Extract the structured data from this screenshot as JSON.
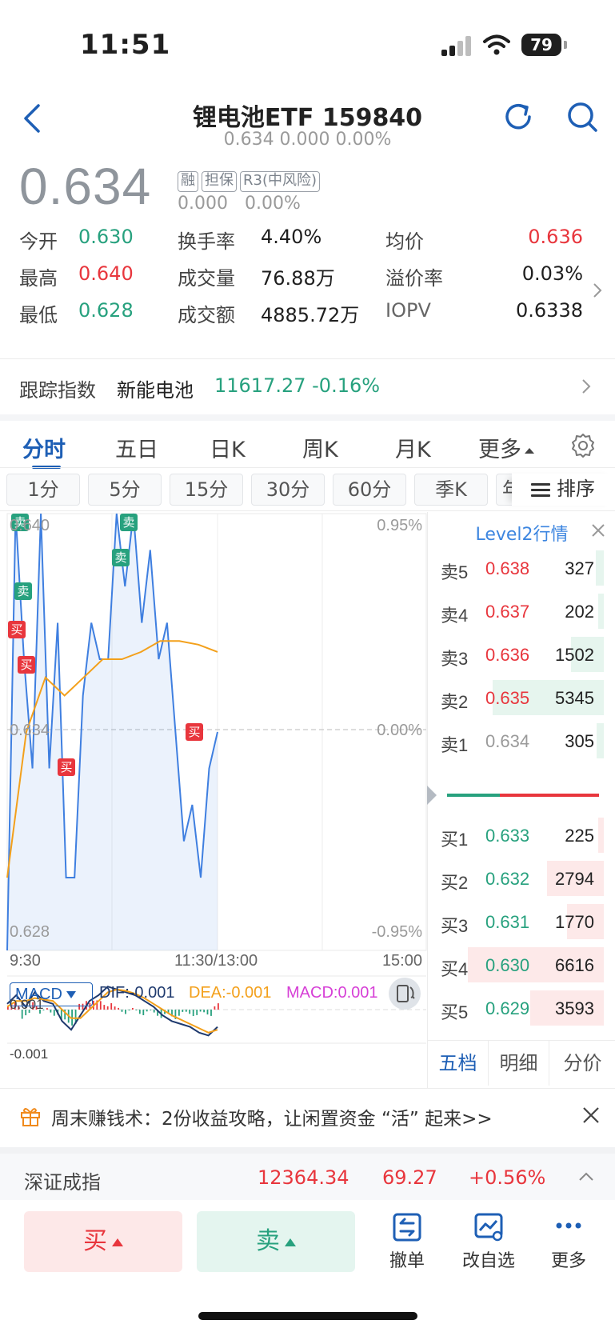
{
  "status": {
    "time": "11:51",
    "battery": "79"
  },
  "header": {
    "title": "锂电池ETF 159840",
    "subtitle": "0.634 0.000 0.00%"
  },
  "price": {
    "last": "0.634",
    "change": "0.000  0.00%",
    "tags": [
      "融",
      "担保",
      "R3(中风险)"
    ]
  },
  "quote": {
    "open_label": "今开",
    "open": "0.630",
    "high_label": "最高",
    "high": "0.640",
    "low_label": "最低",
    "low": "0.628",
    "turnover_label": "换手率",
    "turnover": "4.40%",
    "volume_label": "成交量",
    "volume": "76.88万",
    "amount_label": "成交额",
    "amount": "4885.72万",
    "avg_label": "均价",
    "avg": "0.636",
    "premium_label": "溢价率",
    "premium": "0.03%",
    "iopv_label": "IOPV",
    "iopv": "0.6338"
  },
  "track": {
    "label": "跟踪指数",
    "name": "新能电池",
    "value": "11617.27 -0.16%"
  },
  "tabs": [
    "分时",
    "五日",
    "日K",
    "周K",
    "月K",
    "更多"
  ],
  "period_tabs": [
    "1分",
    "5分",
    "15分",
    "30分",
    "60分",
    "季K",
    "年"
  ],
  "sort_label": "排序",
  "chart": {
    "ymax": "0.640",
    "ymid": "0.634",
    "ymin": "0.628",
    "pmax": "0.95%",
    "pmid": "0.00%",
    "pmin": "-0.95%",
    "t_start": "9:30",
    "t_mid": "11:30/13:00",
    "t_end": "15:00",
    "buy_mark": "买",
    "sell_mark": "卖",
    "colors": {
      "price": "#3f7fe0",
      "avg": "#f3a01b"
    }
  },
  "chart_data": {
    "type": "line",
    "ylim": [
      0.628,
      0.64
    ],
    "series": [
      {
        "values": [
          0.628,
          0.64,
          0.636,
          0.633,
          0.64,
          0.633,
          0.637,
          0.63,
          0.63,
          0.635,
          0.637,
          0.636,
          0.636,
          0.64,
          0.638,
          0.64,
          0.637,
          0.639,
          0.636,
          0.637,
          0.634,
          0.631,
          0.632,
          0.63,
          0.633,
          0.634
        ]
      },
      {
        "values": [
          0.63,
          0.634,
          0.6355,
          0.635,
          0.6355,
          0.636,
          0.636,
          0.6362,
          0.6365,
          0.6365,
          0.6364,
          0.6362
        ]
      }
    ]
  },
  "macd": {
    "selector": "MACD",
    "dif": "DIF:-0.001",
    "dea": "DEA:-0.001",
    "macd": "MACD:0.001",
    "top": "0.001",
    "bottom": "-0.001"
  },
  "level2": {
    "title": "Level2行情",
    "asks": [
      {
        "k": "卖5",
        "p": "0.638",
        "v": "327",
        "w": 0.06
      },
      {
        "k": "卖4",
        "p": "0.637",
        "v": "202",
        "w": 0.04
      },
      {
        "k": "卖3",
        "p": "0.636",
        "v": "1502",
        "w": 0.24
      },
      {
        "k": "卖2",
        "p": "0.635",
        "v": "5345",
        "w": 0.82
      },
      {
        "k": "卖1",
        "p": "0.634",
        "v": "305",
        "w": 0.05
      }
    ],
    "bids": [
      {
        "k": "买1",
        "p": "0.633",
        "v": "225",
        "w": 0.04
      },
      {
        "k": "买2",
        "p": "0.632",
        "v": "2794",
        "w": 0.42
      },
      {
        "k": "买3",
        "p": "0.631",
        "v": "1770",
        "w": 0.27
      },
      {
        "k": "买4",
        "p": "0.630",
        "v": "6616",
        "w": 1.0
      },
      {
        "k": "买5",
        "p": "0.629",
        "v": "3593",
        "w": 0.54
      }
    ],
    "tabs": [
      "五档",
      "明细",
      "分价"
    ]
  },
  "promo": {
    "text": "周末赚钱术：2份收益攻略，让闲置资金 “活” 起来>>"
  },
  "index": {
    "name": "深证成指",
    "value": "12364.34",
    "change": "69.27",
    "pct": "+0.56%"
  },
  "toolbar": {
    "buy": "买",
    "sell": "卖",
    "cancel": "撤单",
    "watch": "改自选",
    "more": "更多"
  }
}
